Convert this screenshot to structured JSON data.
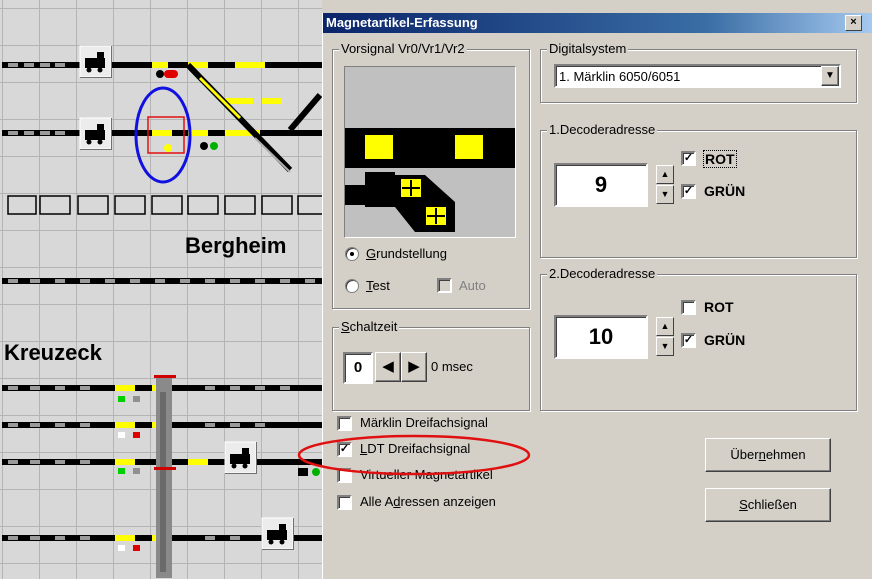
{
  "plan": {
    "label_station": "Bergheim",
    "label_left": "Kreuzeck"
  },
  "dialog": {
    "title": "Magnetartikel-Erfassung",
    "close_icon": "close-icon",
    "vorsignal": {
      "legend": "Vorsignal Vr0/Vr1/Vr2",
      "radio_grundstellung": "Grundstellung",
      "radio_grundstellung_mnemonic": "G",
      "radio_grundstellung_rest": "rundstellung",
      "radio_test": "Test",
      "radio_test_mnemonic": "T",
      "radio_test_rest": "est",
      "selected": "Grundstellung",
      "auto_label": "Auto",
      "auto_checked": false
    },
    "schaltzeit": {
      "legend": "Schaltzeit",
      "legend_mnemonic": "S",
      "legend_rest": "chaltzeit",
      "value": "0",
      "unit_text": "0 msec"
    },
    "digitalsystem": {
      "legend": "Digitalsystem",
      "selected": "1. Märklin 6050/6051"
    },
    "decoder1": {
      "legend": "1.Decoderadresse",
      "value": "9",
      "rot_label": "ROT",
      "rot_checked": true,
      "gruen_label": "GRÜN",
      "gruen_checked": true
    },
    "decoder2": {
      "legend": "2.Decoderadresse",
      "value": "10",
      "rot_label": "ROT",
      "rot_checked": false,
      "gruen_label": "GRÜN",
      "gruen_checked": true
    },
    "options": [
      {
        "label": "Märklin Dreifachsignal",
        "checked": false
      },
      {
        "label": "LDT Dreifachsignal",
        "checked": true
      },
      {
        "label": "Virtueller Magnetartikel",
        "checked": false
      },
      {
        "label": "Alle Adressen anzeigen",
        "checked": false
      }
    ],
    "options_mn": {
      "ldt_mn": "L",
      "ldt_rest": "DT Dreifachsignal",
      "alle_a": "Alle A",
      "alle_mn": "d",
      "alle_rest": "ressen anzeigen"
    },
    "buttons": {
      "uebernehmen_pre": "Über",
      "uebernehmen_mn": "n",
      "uebernehmen_post": "ehmen",
      "schliessen_mn": "S",
      "schliessen_post": "chließen"
    },
    "colors": {
      "highlight_red": "#e01010",
      "highlight_blue": "#1010e0",
      "signal_yellow": "#ffff00"
    }
  }
}
